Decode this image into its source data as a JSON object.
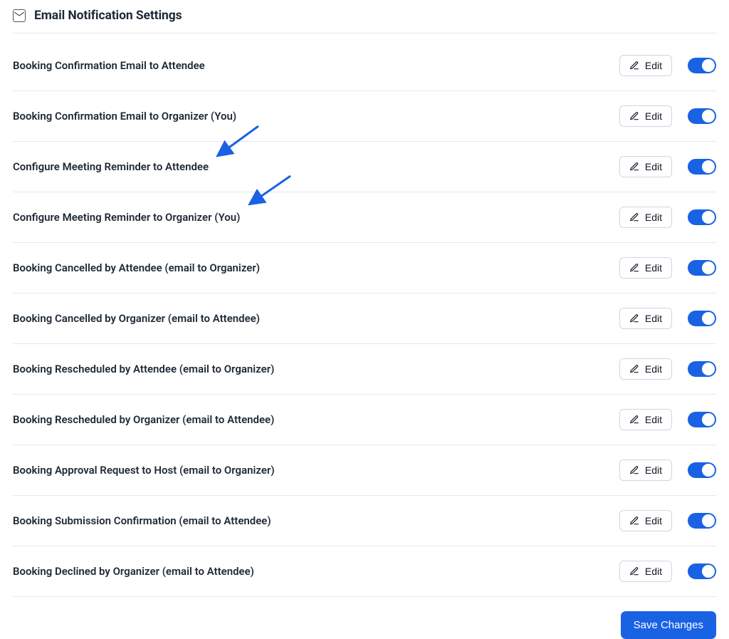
{
  "header": {
    "title": "Email Notification Settings"
  },
  "edit_label": "Edit",
  "rows": [
    {
      "label": "Booking Confirmation Email to Attendee"
    },
    {
      "label": "Booking Confirmation Email to Organizer (You)"
    },
    {
      "label": "Configure Meeting Reminder to Attendee"
    },
    {
      "label": "Configure Meeting Reminder to Organizer (You)"
    },
    {
      "label": "Booking Cancelled by Attendee (email to Organizer)"
    },
    {
      "label": "Booking Cancelled by Organizer (email to Attendee)"
    },
    {
      "label": "Booking Rescheduled by Attendee (email to Organizer)"
    },
    {
      "label": "Booking Rescheduled by Organizer (email to Attendee)"
    },
    {
      "label": "Booking Approval Request to Host (email to Organizer)"
    },
    {
      "label": "Booking Submission Confirmation (email to Attendee)"
    },
    {
      "label": "Booking Declined by Organizer (email to Attendee)"
    }
  ],
  "footer": {
    "save_label": "Save Changes"
  }
}
